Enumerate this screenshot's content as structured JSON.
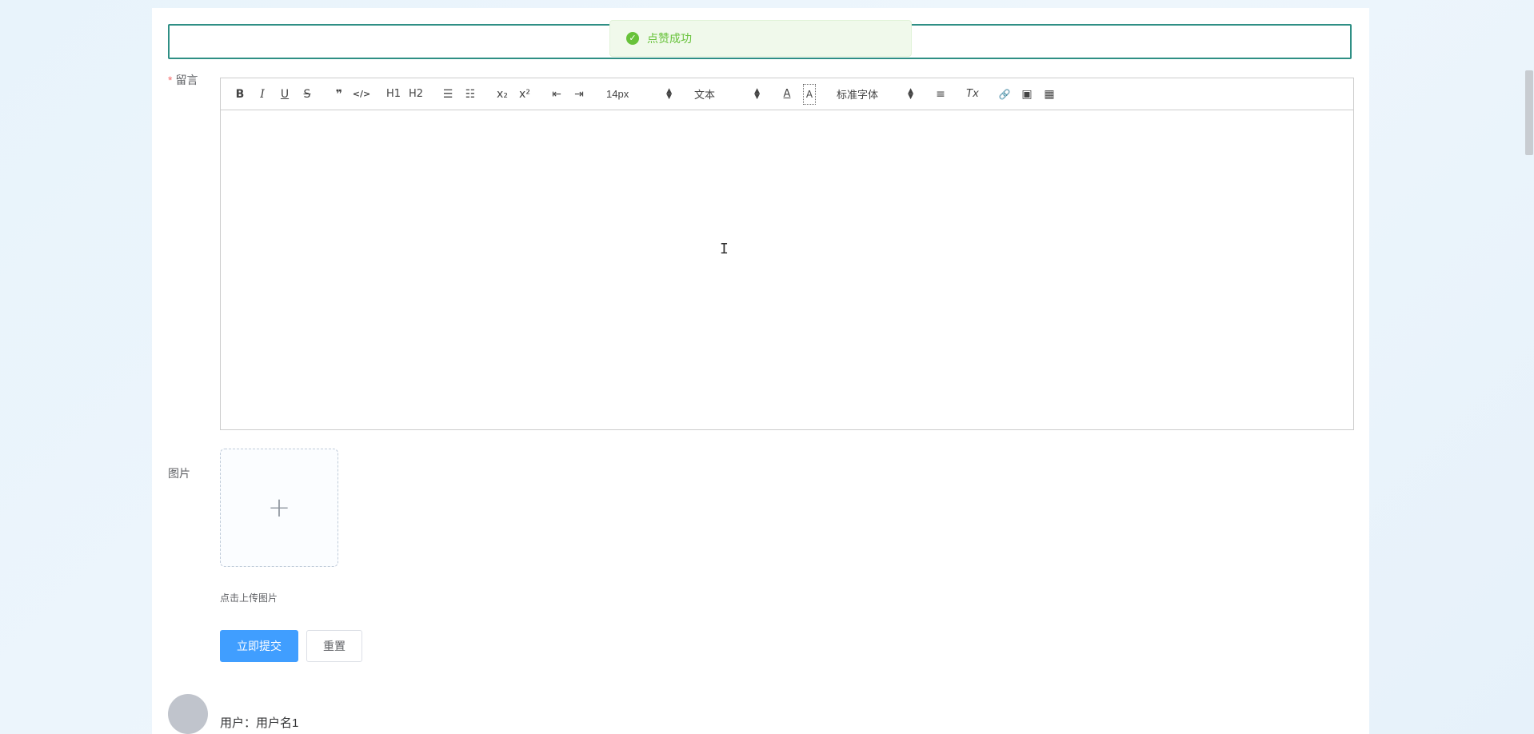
{
  "toast": {
    "icon": "check-circle-icon",
    "message": "点赞成功",
    "color": "#67c23a"
  },
  "form": {
    "message_label": "留言",
    "required_mark": "*",
    "image_label": "图片",
    "upload_tip": "点击上传图片",
    "submit_label": "立即提交",
    "reset_label": "重置"
  },
  "toolbar": {
    "bold": "B",
    "italic": "I",
    "underline": "U",
    "strike": "S",
    "blockquote": "❞",
    "code": "</>",
    "h1": "H1",
    "h2": "H2",
    "ordered_list": "☰",
    "bullet_list": "☷",
    "subscript": "x₂",
    "superscript": "x²",
    "outdent": "⇤",
    "indent": "⇥",
    "font_size": "14px",
    "header_select": "文本",
    "font_color": "A",
    "background_color": "A",
    "font_family": "标准字体",
    "align": "≡",
    "clean": "Tx",
    "link": "🔗",
    "image": "▣",
    "video": "▦"
  },
  "comments": [
    {
      "user": "用户：用户名1"
    }
  ],
  "colors": {
    "primary": "#409eff",
    "success": "#67c23a",
    "input_border": "#2f8f85"
  }
}
